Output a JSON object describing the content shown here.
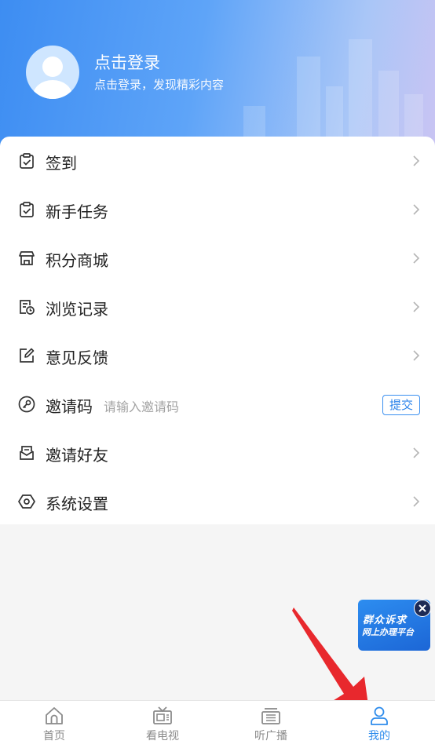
{
  "profile": {
    "title": "点击登录",
    "subtitle": "点击登录，发现精彩内容"
  },
  "menu": [
    {
      "label": "签到",
      "icon": "calendar-check-icon"
    },
    {
      "label": "新手任务",
      "icon": "task-icon"
    },
    {
      "label": "积分商城",
      "icon": "store-icon"
    },
    {
      "label": "浏览记录",
      "icon": "history-icon"
    },
    {
      "label": "意见反馈",
      "icon": "edit-icon"
    },
    {
      "label": "邀请码",
      "icon": "key-icon",
      "placeholder": "请输入邀请码",
      "button": "提交"
    },
    {
      "label": "邀请好友",
      "icon": "mail-icon"
    },
    {
      "label": "系统设置",
      "icon": "settings-icon"
    }
  ],
  "float_ad": {
    "line1": "群众诉求",
    "line2": "网上办理平台"
  },
  "tabs": [
    {
      "label": "首页",
      "icon": "home-icon"
    },
    {
      "label": "看电视",
      "icon": "tv-icon"
    },
    {
      "label": "听广播",
      "icon": "radio-icon"
    },
    {
      "label": "我的",
      "icon": "user-icon",
      "active": true
    }
  ],
  "colors": {
    "accent": "#2e8cec",
    "header_start": "#3d8df2",
    "header_end": "#c9c4f3"
  }
}
